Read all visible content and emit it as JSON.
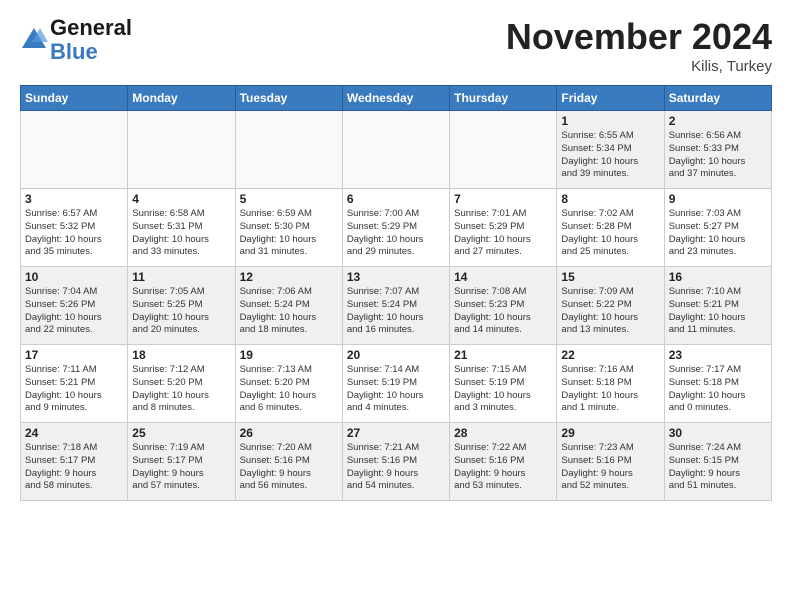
{
  "header": {
    "logo_line1": "General",
    "logo_line2": "Blue",
    "month": "November 2024",
    "location": "Kilis, Turkey"
  },
  "days_of_week": [
    "Sunday",
    "Monday",
    "Tuesday",
    "Wednesday",
    "Thursday",
    "Friday",
    "Saturday"
  ],
  "weeks": [
    [
      {
        "day": "",
        "info": "",
        "empty": true
      },
      {
        "day": "",
        "info": "",
        "empty": true
      },
      {
        "day": "",
        "info": "",
        "empty": true
      },
      {
        "day": "",
        "info": "",
        "empty": true
      },
      {
        "day": "",
        "info": "",
        "empty": true
      },
      {
        "day": "1",
        "info": "Sunrise: 6:55 AM\nSunset: 5:34 PM\nDaylight: 10 hours\nand 39 minutes.",
        "empty": false
      },
      {
        "day": "2",
        "info": "Sunrise: 6:56 AM\nSunset: 5:33 PM\nDaylight: 10 hours\nand 37 minutes.",
        "empty": false
      }
    ],
    [
      {
        "day": "3",
        "info": "Sunrise: 6:57 AM\nSunset: 5:32 PM\nDaylight: 10 hours\nand 35 minutes.",
        "empty": false
      },
      {
        "day": "4",
        "info": "Sunrise: 6:58 AM\nSunset: 5:31 PM\nDaylight: 10 hours\nand 33 minutes.",
        "empty": false
      },
      {
        "day": "5",
        "info": "Sunrise: 6:59 AM\nSunset: 5:30 PM\nDaylight: 10 hours\nand 31 minutes.",
        "empty": false
      },
      {
        "day": "6",
        "info": "Sunrise: 7:00 AM\nSunset: 5:29 PM\nDaylight: 10 hours\nand 29 minutes.",
        "empty": false
      },
      {
        "day": "7",
        "info": "Sunrise: 7:01 AM\nSunset: 5:29 PM\nDaylight: 10 hours\nand 27 minutes.",
        "empty": false
      },
      {
        "day": "8",
        "info": "Sunrise: 7:02 AM\nSunset: 5:28 PM\nDaylight: 10 hours\nand 25 minutes.",
        "empty": false
      },
      {
        "day": "9",
        "info": "Sunrise: 7:03 AM\nSunset: 5:27 PM\nDaylight: 10 hours\nand 23 minutes.",
        "empty": false
      }
    ],
    [
      {
        "day": "10",
        "info": "Sunrise: 7:04 AM\nSunset: 5:26 PM\nDaylight: 10 hours\nand 22 minutes.",
        "empty": false
      },
      {
        "day": "11",
        "info": "Sunrise: 7:05 AM\nSunset: 5:25 PM\nDaylight: 10 hours\nand 20 minutes.",
        "empty": false
      },
      {
        "day": "12",
        "info": "Sunrise: 7:06 AM\nSunset: 5:24 PM\nDaylight: 10 hours\nand 18 minutes.",
        "empty": false
      },
      {
        "day": "13",
        "info": "Sunrise: 7:07 AM\nSunset: 5:24 PM\nDaylight: 10 hours\nand 16 minutes.",
        "empty": false
      },
      {
        "day": "14",
        "info": "Sunrise: 7:08 AM\nSunset: 5:23 PM\nDaylight: 10 hours\nand 14 minutes.",
        "empty": false
      },
      {
        "day": "15",
        "info": "Sunrise: 7:09 AM\nSunset: 5:22 PM\nDaylight: 10 hours\nand 13 minutes.",
        "empty": false
      },
      {
        "day": "16",
        "info": "Sunrise: 7:10 AM\nSunset: 5:21 PM\nDaylight: 10 hours\nand 11 minutes.",
        "empty": false
      }
    ],
    [
      {
        "day": "17",
        "info": "Sunrise: 7:11 AM\nSunset: 5:21 PM\nDaylight: 10 hours\nand 9 minutes.",
        "empty": false
      },
      {
        "day": "18",
        "info": "Sunrise: 7:12 AM\nSunset: 5:20 PM\nDaylight: 10 hours\nand 8 minutes.",
        "empty": false
      },
      {
        "day": "19",
        "info": "Sunrise: 7:13 AM\nSunset: 5:20 PM\nDaylight: 10 hours\nand 6 minutes.",
        "empty": false
      },
      {
        "day": "20",
        "info": "Sunrise: 7:14 AM\nSunset: 5:19 PM\nDaylight: 10 hours\nand 4 minutes.",
        "empty": false
      },
      {
        "day": "21",
        "info": "Sunrise: 7:15 AM\nSunset: 5:19 PM\nDaylight: 10 hours\nand 3 minutes.",
        "empty": false
      },
      {
        "day": "22",
        "info": "Sunrise: 7:16 AM\nSunset: 5:18 PM\nDaylight: 10 hours\nand 1 minute.",
        "empty": false
      },
      {
        "day": "23",
        "info": "Sunrise: 7:17 AM\nSunset: 5:18 PM\nDaylight: 10 hours\nand 0 minutes.",
        "empty": false
      }
    ],
    [
      {
        "day": "24",
        "info": "Sunrise: 7:18 AM\nSunset: 5:17 PM\nDaylight: 9 hours\nand 58 minutes.",
        "empty": false
      },
      {
        "day": "25",
        "info": "Sunrise: 7:19 AM\nSunset: 5:17 PM\nDaylight: 9 hours\nand 57 minutes.",
        "empty": false
      },
      {
        "day": "26",
        "info": "Sunrise: 7:20 AM\nSunset: 5:16 PM\nDaylight: 9 hours\nand 56 minutes.",
        "empty": false
      },
      {
        "day": "27",
        "info": "Sunrise: 7:21 AM\nSunset: 5:16 PM\nDaylight: 9 hours\nand 54 minutes.",
        "empty": false
      },
      {
        "day": "28",
        "info": "Sunrise: 7:22 AM\nSunset: 5:16 PM\nDaylight: 9 hours\nand 53 minutes.",
        "empty": false
      },
      {
        "day": "29",
        "info": "Sunrise: 7:23 AM\nSunset: 5:16 PM\nDaylight: 9 hours\nand 52 minutes.",
        "empty": false
      },
      {
        "day": "30",
        "info": "Sunrise: 7:24 AM\nSunset: 5:15 PM\nDaylight: 9 hours\nand 51 minutes.",
        "empty": false
      }
    ]
  ]
}
